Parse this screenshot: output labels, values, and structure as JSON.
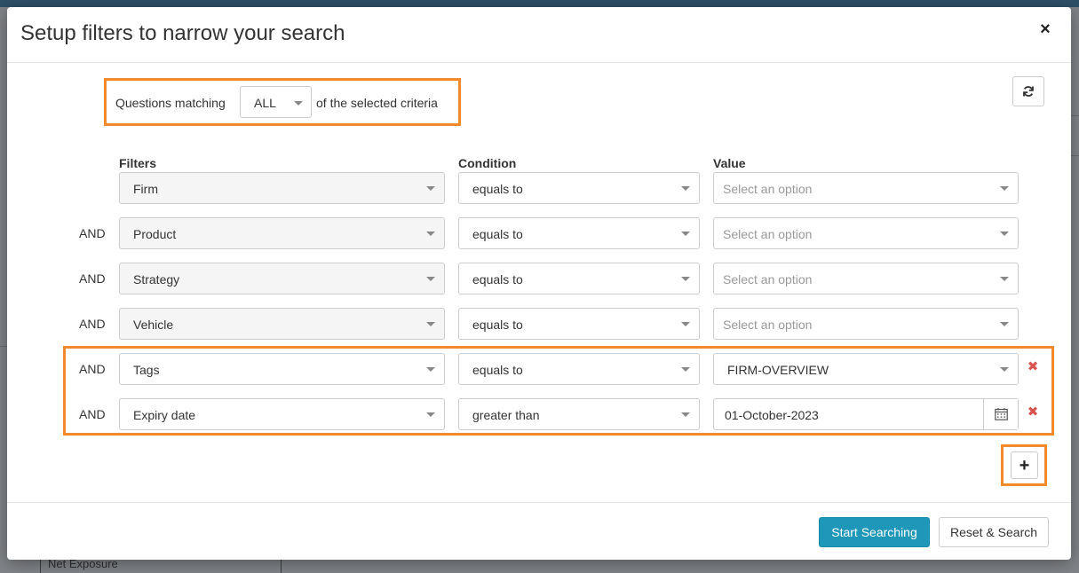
{
  "modal": {
    "title": "Setup filters to narrow your search",
    "close_label": "×"
  },
  "match": {
    "prefix": "Questions matching",
    "selected": "ALL",
    "suffix": "of the selected criteria"
  },
  "columns": {
    "filters": "Filters",
    "condition": "Condition",
    "value": "Value"
  },
  "rows": [
    {
      "connector": "",
      "filter": "Firm",
      "condition": "equals to",
      "value": "",
      "placeholder": "Select an option",
      "removable": false
    },
    {
      "connector": "AND",
      "filter": "Product",
      "condition": "equals to",
      "value": "",
      "placeholder": "Select an option",
      "removable": false
    },
    {
      "connector": "AND",
      "filter": "Strategy",
      "condition": "equals to",
      "value": "",
      "placeholder": "Select an option",
      "removable": false
    },
    {
      "connector": "AND",
      "filter": "Vehicle",
      "condition": "equals to",
      "value": "",
      "placeholder": "Select an option",
      "removable": false
    },
    {
      "connector": "AND",
      "filter": "Tags",
      "condition": "equals to",
      "value": "FIRM-OVERVIEW",
      "placeholder": "",
      "removable": true
    },
    {
      "connector": "AND",
      "filter": "Expiry date",
      "condition": "greater than",
      "value": "01-October-2023",
      "placeholder": "",
      "removable": true
    }
  ],
  "remove_label": "✖",
  "add_label": "+",
  "footer": {
    "start_searching": "Start Searching",
    "reset_search": "Reset & Search"
  },
  "background": {
    "table_cell": "Net Exposure"
  },
  "colors": {
    "highlight": "#f08a2c",
    "primary": "#1e97b9",
    "danger": "#d9534f"
  },
  "icons": {
    "refresh": "refresh-icon",
    "calendar": "calendar-icon",
    "close": "close-icon",
    "remove": "remove-icon",
    "add": "plus-icon"
  }
}
